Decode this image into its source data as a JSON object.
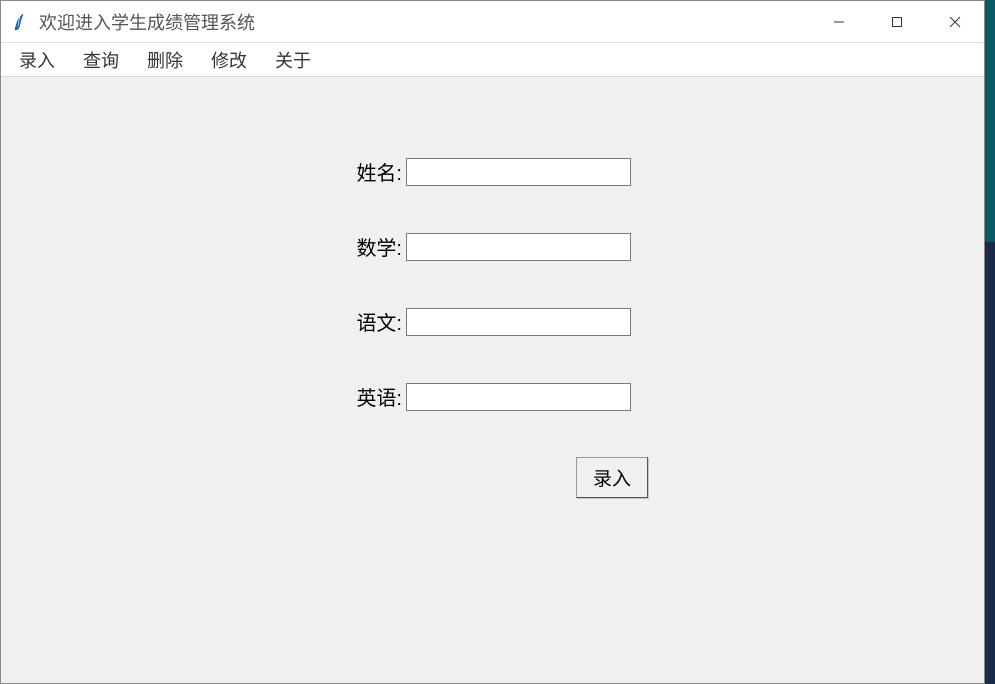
{
  "window": {
    "title": "欢迎进入学生成绩管理系统"
  },
  "menu": {
    "items": [
      "录入",
      "查询",
      "删除",
      "修改",
      "关于"
    ]
  },
  "form": {
    "fields": [
      {
        "label": "姓名:",
        "value": ""
      },
      {
        "label": "数学:",
        "value": ""
      },
      {
        "label": "语文:",
        "value": ""
      },
      {
        "label": "英语:",
        "value": ""
      }
    ],
    "submit_label": "录入"
  }
}
